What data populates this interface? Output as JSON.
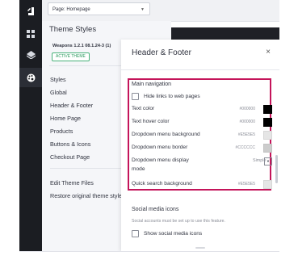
{
  "topbar": {
    "page_select_value": "Page: Homepage"
  },
  "theme_panel": {
    "title": "Theme Styles",
    "theme_name": "Weapons 1.2.1 08.1.24-3 (1)",
    "active_badge": "ACTIVE THEME",
    "nav_items": [
      "Styles",
      "Global",
      "Header & Footer",
      "Home Page",
      "Products",
      "Buttons & Icons",
      "Checkout Page"
    ],
    "actions": [
      "Edit Theme Files",
      "Restore original theme styles"
    ]
  },
  "header_footer": {
    "title": "Header & Footer",
    "close_glyph": "×",
    "main_navigation": {
      "title": "Main navigation",
      "hide_links_label": "Hide links to web pages",
      "rows": [
        {
          "label": "Text color",
          "hex": "#000000",
          "swatch": "#000000"
        },
        {
          "label": "Text hover color",
          "hex": "#000000",
          "swatch": "#000000"
        },
        {
          "label": "Dropdown menu background",
          "hex": "#E5E5E5",
          "swatch": "#E5E5E5"
        },
        {
          "label": "Dropdown menu border",
          "hex": "#CCCCCC",
          "swatch": "#CCCCCC"
        }
      ],
      "display_mode_label_1": "Dropdown menu display",
      "display_mode_label_2": "mode",
      "display_mode_value": "Simple",
      "quick_search": {
        "label": "Quick search background",
        "hex": "#E5E5E5",
        "swatch": "#E5E5E5"
      }
    },
    "social": {
      "title": "Social media icons",
      "hint": "Social accounts must be set up to use this feature.",
      "show_label": "Show social media icons"
    }
  },
  "colors": {
    "highlight": "#c4145a",
    "active_badge": "#2a9a5e",
    "rail": "#1b1d22"
  },
  "icons": [
    "logo-icon",
    "dashboard-icon",
    "layers-icon",
    "palette-icon",
    "chevron-down-icon",
    "close-icon",
    "checkbox-icon"
  ]
}
